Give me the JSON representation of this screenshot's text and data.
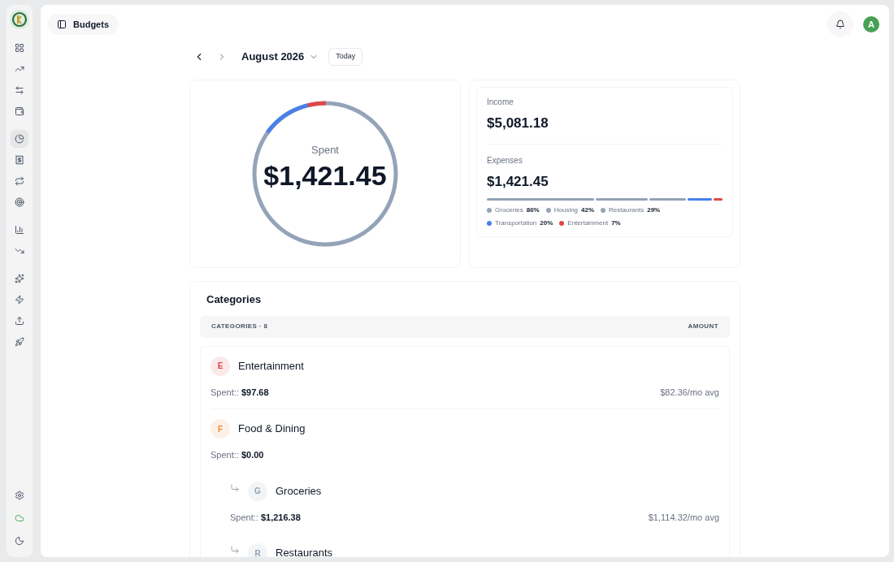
{
  "sidebar": {
    "groups": [
      [
        {
          "selected": false
        },
        {
          "selected": false
        },
        {
          "selected": false
        },
        {
          "selected": false
        }
      ],
      [
        {
          "selected": true
        },
        {
          "selected": false
        },
        {
          "selected": false
        },
        {
          "selected": false
        }
      ],
      [
        {
          "selected": false
        },
        {
          "selected": false
        }
      ],
      [
        {
          "selected": false
        },
        {
          "selected": false
        },
        {
          "selected": false
        },
        {
          "selected": false
        }
      ]
    ]
  },
  "header": {
    "title": "Budgets",
    "avatar": "A"
  },
  "period": {
    "label": "August 2026",
    "today": "Today"
  },
  "spent": {
    "label": "Spent",
    "amount": "$1,421.45"
  },
  "summary": {
    "income_label": "Income",
    "income": "$5,081.18",
    "expenses_label": "Expenses",
    "expenses": "$1,421.45",
    "breakdown": [
      {
        "name": "Groceries",
        "percent": "86%",
        "color": "#94a3b8"
      },
      {
        "name": "Housing",
        "percent": "42%",
        "color": "#94a3b8"
      },
      {
        "name": "Restaurants",
        "percent": "29%",
        "color": "#94a3b8"
      },
      {
        "name": "Transportation",
        "percent": "20%",
        "color": "#4a80e8"
      },
      {
        "name": "Entertainment",
        "percent": "7%",
        "color": "#e04848"
      }
    ]
  },
  "categories": {
    "title": "Categories",
    "column_1": "CATEGORIES · 8",
    "column_2": "AMOUNT",
    "items": [
      {
        "initial": "E",
        "name": "Entertainment",
        "color": "#e04848",
        "spent_label": "Spent::",
        "spent": "$97.68",
        "average": "$82.36/mo avg"
      },
      {
        "initial": "F",
        "name": "Food & Dining",
        "color": "#f08a3c",
        "spent_label": "Spent::",
        "spent": "$0.00",
        "children": [
          {
            "initial": "G",
            "name": "Groceries",
            "color": "#94a3b8",
            "spent_label": "Spent::",
            "spent": "$1,216.38",
            "average": "$1,114.32/mo avg"
          },
          {
            "initial": "R",
            "name": "Restaurants",
            "color": "#94a3b8"
          }
        ]
      }
    ]
  }
}
